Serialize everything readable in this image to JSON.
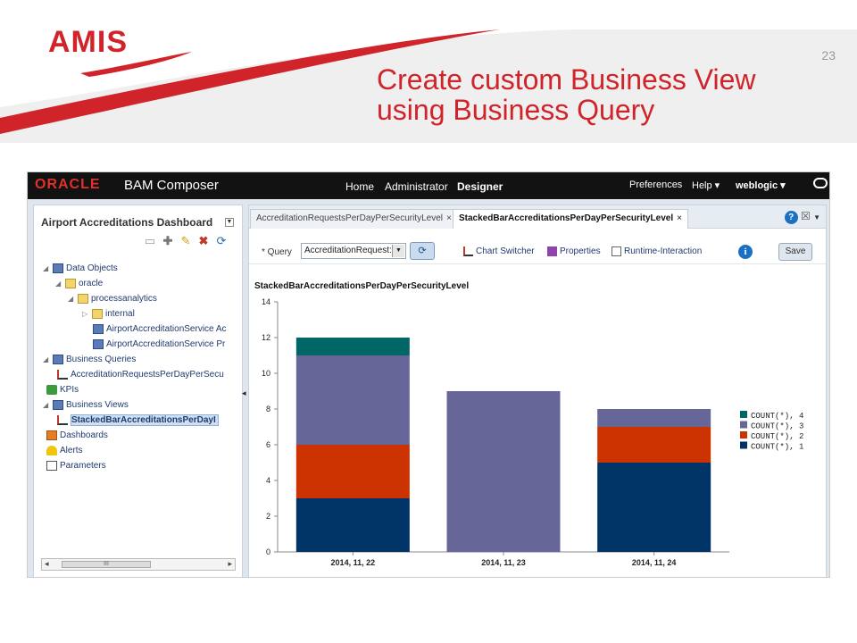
{
  "slide": {
    "logo": "AMIS",
    "number": "23",
    "title_line1": "Create custom Business View",
    "title_line2": "using Business Query",
    "colors": {
      "accent": "#d1232a"
    }
  },
  "app": {
    "brand": "ORACLE",
    "name": "BAM Composer",
    "nav": [
      "Home",
      "Administrator",
      "Designer"
    ],
    "nav_active": "Designer",
    "preferences": "Preferences",
    "help": "Help ▾",
    "user": "weblogic ▾"
  },
  "left": {
    "title": "Airport Accreditations Dashboard",
    "toolbar_icons": [
      "new-folder-icon",
      "add-icon",
      "edit-icon",
      "delete-icon",
      "refresh-icon"
    ],
    "tree": [
      {
        "label": "Data Objects",
        "icon": "data-objects-icon"
      },
      {
        "label": "oracle",
        "icon": "folder-icon"
      },
      {
        "label": "processanalytics",
        "icon": "folder-icon"
      },
      {
        "label": "internal",
        "icon": "folder-icon"
      },
      {
        "label": "AirportAccreditationService Ac",
        "icon": "data-object-icon"
      },
      {
        "label": "AirportAccreditationService Pr",
        "icon": "data-object-icon"
      },
      {
        "label": "Business Queries",
        "icon": "business-queries-icon"
      },
      {
        "label": "AccreditationRequestsPerDayPerSecu",
        "icon": "query-icon"
      },
      {
        "label": "KPIs",
        "icon": "kpi-icon"
      },
      {
        "label": "Business Views",
        "icon": "business-views-icon"
      },
      {
        "label": "StackedBarAccreditationsPerDayI",
        "icon": "chart-icon"
      },
      {
        "label": "Dashboards",
        "icon": "dashboards-icon"
      },
      {
        "label": "Alerts",
        "icon": "alerts-icon"
      },
      {
        "label": "Parameters",
        "icon": "parameters-icon"
      }
    ],
    "scroll_label": "III"
  },
  "right": {
    "tabs": [
      {
        "label": "AccreditationRequestsPerDayPerSecurityLevel",
        "close": "×"
      },
      {
        "label": "StackedBarAccreditationsPerDayPerSecurityLevel",
        "close": "×"
      }
    ],
    "query_label": "* Query",
    "query_value": "AccreditationRequest:",
    "toolbar": {
      "chart_switcher": "Chart Switcher",
      "properties": "Properties",
      "runtime_interaction": "Runtime-Interaction",
      "save": "Save"
    },
    "view_title": "StackedBarAccreditationsPerDayPerSecurityLevel"
  },
  "chart_data": {
    "type": "bar",
    "stacked": true,
    "title": "StackedBarAccreditationsPerDayPerSecurityLevel",
    "categories": [
      "2014, 11, 22",
      "2014, 11, 23",
      "2014, 11, 24"
    ],
    "series": [
      {
        "name": "COUNT(*), 1",
        "values": [
          3,
          0,
          5
        ],
        "color": "#003366"
      },
      {
        "name": "COUNT(*), 2",
        "values": [
          3,
          0,
          2
        ],
        "color": "#cc3300"
      },
      {
        "name": "COUNT(*), 3",
        "values": [
          5,
          9,
          1
        ],
        "color": "#666699"
      },
      {
        "name": "COUNT(*), 4",
        "values": [
          1,
          0,
          0
        ],
        "color": "#006666"
      }
    ],
    "yticks": [
      0,
      2,
      4,
      6,
      8,
      10,
      12,
      14
    ],
    "ylim": [
      0,
      14
    ],
    "legend_position": "right",
    "legend_order": [
      "COUNT(*), 4",
      "COUNT(*), 3",
      "COUNT(*), 2",
      "COUNT(*), 1"
    ]
  }
}
